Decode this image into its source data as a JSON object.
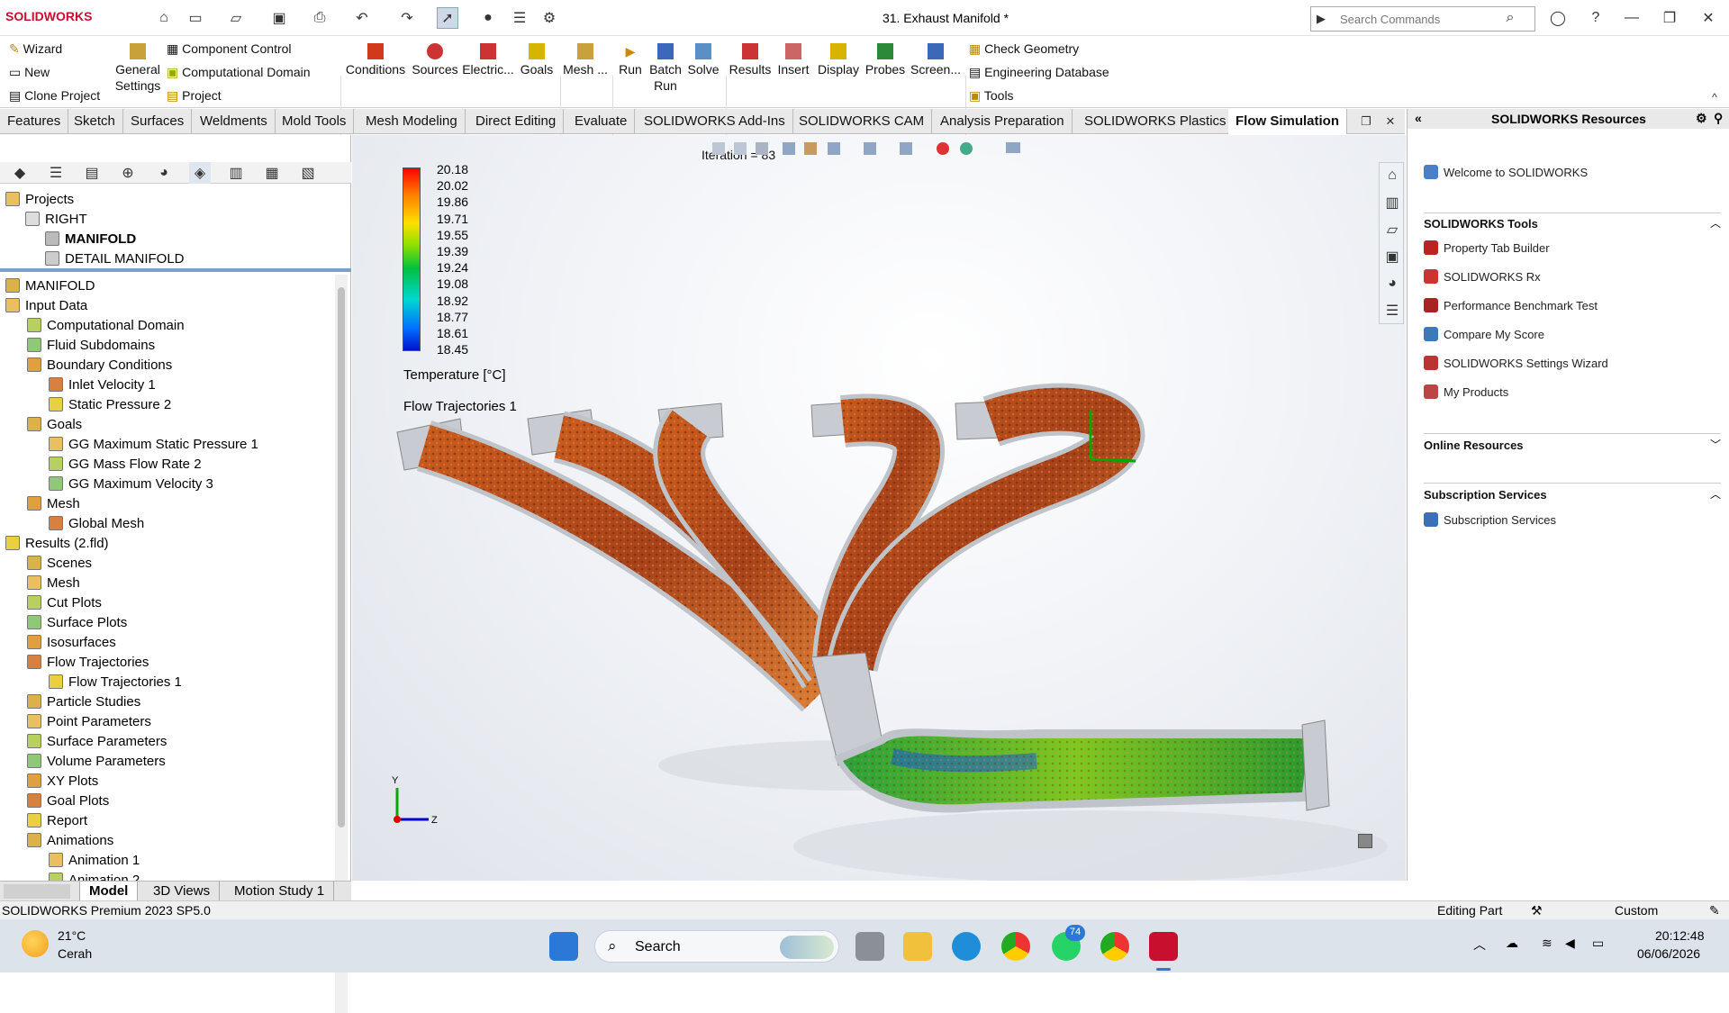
{
  "app": {
    "logo": "SOLIDWORKS",
    "title": "31. Exhaust Manifold *",
    "search_placeholder": "Search Commands"
  },
  "ribbon": {
    "wizard": "Wizard",
    "new": "New",
    "clone": "Clone Project",
    "general_settings": "General Settings",
    "component_control": "Component Control",
    "computational_domain": "Computational Domain",
    "project": "Project",
    "conditions": "Conditions",
    "sources": "Sources",
    "electric": "Electric...",
    "goals": "Goals",
    "mesh": "Mesh ...",
    "run": "Run",
    "batch_run": "Batch Run",
    "solve": "Solve",
    "results": "Results",
    "insert": "Insert",
    "display": "Display",
    "probes": "Probes",
    "screen": "Screen...",
    "check_geometry": "Check Geometry",
    "engineering_database": "Engineering Database",
    "tools": "Tools"
  },
  "tabs": [
    "Features",
    "Sketch",
    "Surfaces",
    "Weldments",
    "Mold Tools",
    "Mesh Modeling",
    "Direct Editing",
    "Evaluate",
    "SOLIDWORKS Add-Ins",
    "SOLIDWORKS CAM",
    "Analysis Preparation",
    "SOLIDWORKS Plastics",
    "Flow Simulation"
  ],
  "active_tab": "Flow Simulation",
  "projects_tree": {
    "root": "Projects",
    "config": "RIGHT",
    "items": [
      "MANIFOLD",
      "DETAIL MANIFOLD"
    ]
  },
  "tree": [
    {
      "label": "MANIFOLD",
      "level": 0
    },
    {
      "label": "Input Data",
      "level": 0
    },
    {
      "label": "Computational Domain",
      "level": 1
    },
    {
      "label": "Fluid Subdomains",
      "level": 1
    },
    {
      "label": "Boundary Conditions",
      "level": 1
    },
    {
      "label": "Inlet Velocity 1",
      "level": 2
    },
    {
      "label": "Static Pressure 2",
      "level": 2
    },
    {
      "label": "Goals",
      "level": 1
    },
    {
      "label": "GG Maximum Static Pressure 1",
      "level": 2
    },
    {
      "label": "GG Mass Flow Rate 2",
      "level": 2
    },
    {
      "label": "GG Maximum Velocity 3",
      "level": 2
    },
    {
      "label": "Mesh",
      "level": 1
    },
    {
      "label": "Global Mesh",
      "level": 2
    },
    {
      "label": "Results (2.fld)",
      "level": 0
    },
    {
      "label": "Scenes",
      "level": 1
    },
    {
      "label": "Mesh",
      "level": 1
    },
    {
      "label": "Cut Plots",
      "level": 1
    },
    {
      "label": "Surface Plots",
      "level": 1
    },
    {
      "label": "Isosurfaces",
      "level": 1
    },
    {
      "label": "Flow Trajectories",
      "level": 1
    },
    {
      "label": "Flow Trajectories 1",
      "level": 2
    },
    {
      "label": "Particle Studies",
      "level": 1
    },
    {
      "label": "Point Parameters",
      "level": 1
    },
    {
      "label": "Surface Parameters",
      "level": 1
    },
    {
      "label": "Volume Parameters",
      "level": 1
    },
    {
      "label": "XY Plots",
      "level": 1
    },
    {
      "label": "Goal Plots",
      "level": 1
    },
    {
      "label": "Report",
      "level": 1
    },
    {
      "label": "Animations",
      "level": 1
    },
    {
      "label": "Animation 1",
      "level": 2
    },
    {
      "label": "Animation 2",
      "level": 2
    }
  ],
  "viewport": {
    "iteration": "Iteration = 83",
    "legend_values": [
      "20.18",
      "20.02",
      "19.86",
      "19.71",
      "19.55",
      "19.39",
      "19.24",
      "19.08",
      "18.92",
      "18.77",
      "18.61",
      "18.45"
    ],
    "legend_title": "Temperature [°C]",
    "plot_name": "Flow Trajectories 1",
    "axis_x": "Z",
    "axis_y": "Y"
  },
  "bottom_tabs": [
    "Model",
    "3D Views",
    "Motion Study 1"
  ],
  "status": {
    "version": "SOLIDWORKS Premium 2023 SP5.0",
    "editing": "Editing Part",
    "units": "Custom"
  },
  "resources": {
    "title": "SOLIDWORKS Resources",
    "welcome": "Welcome to SOLIDWORKS",
    "tools_title": "SOLIDWORKS Tools",
    "tools": [
      "Property Tab Builder",
      "SOLIDWORKS Rx",
      "Performance Benchmark Test",
      "Compare My Score",
      "SOLIDWORKS Settings Wizard",
      "My Products"
    ],
    "online": "Online Resources",
    "subscription_title": "Subscription Services",
    "subscription_item": "Subscription Services"
  },
  "taskbar": {
    "weather_temp": "21°C",
    "weather_desc": "Cerah",
    "search": "Search",
    "badge": "74",
    "time": "20:12:48",
    "date": "06/06/2026"
  }
}
